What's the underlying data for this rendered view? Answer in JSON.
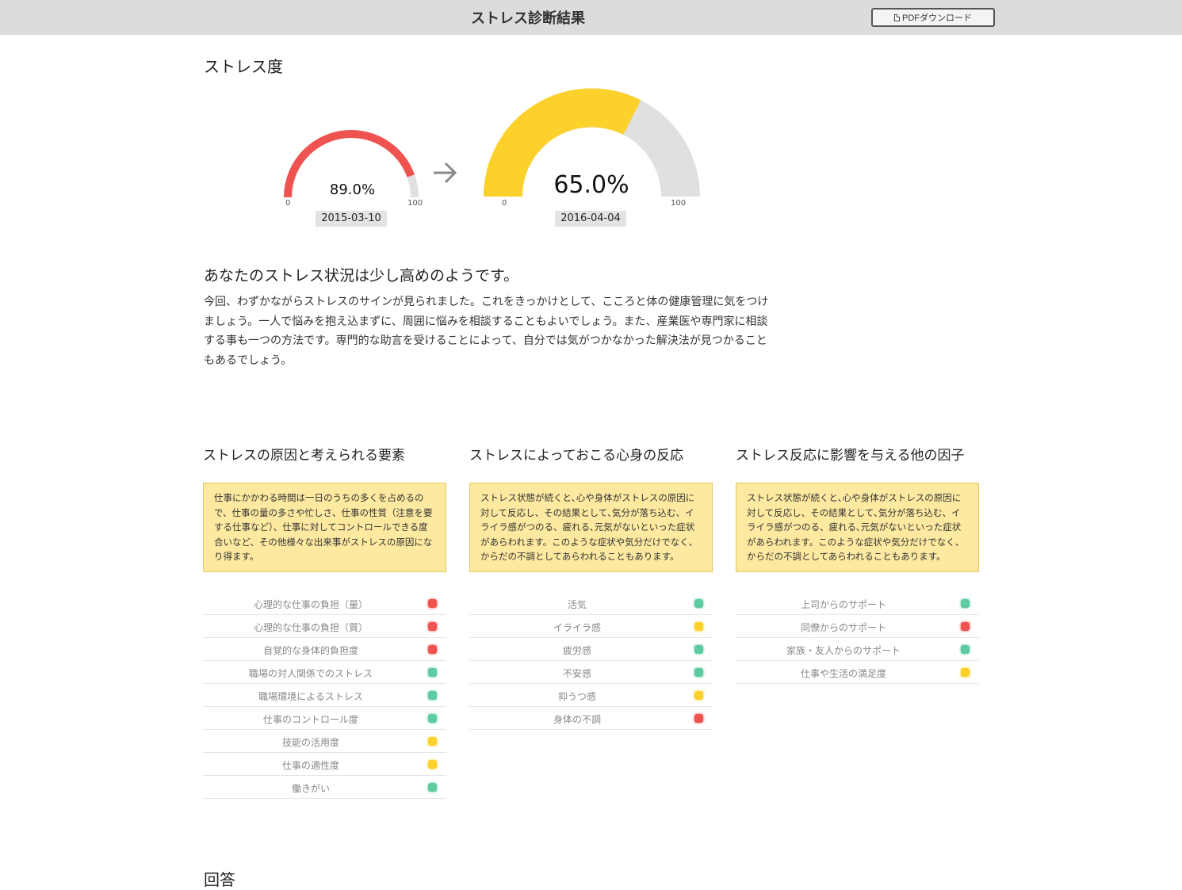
{
  "header": {
    "title": "ストレス診断結果",
    "pdf_button_label": "PDFダウンロード",
    "pdf_icon": "document-icon"
  },
  "stress": {
    "section_title": "ストレス度",
    "previous": {
      "value_label": "89.0%",
      "level": 0.89,
      "date": "2015-03-10",
      "min": "0",
      "max": "100",
      "color": "#ef5350"
    },
    "current": {
      "value_label": "65.0%",
      "level": 0.65,
      "date": "2016-04-04",
      "min": "0",
      "max": "100",
      "color": "#fdd12b"
    },
    "track_color": "#e0e0e0",
    "arrow_icon": "arrow-right-icon"
  },
  "summary": {
    "headline": "あなたのストレス状況は少し高めのようです。",
    "text": "今回、わずかながらストレスのサインが見られました。これをきっかけとして、こころと体の健康管理に気をつけましょう。一人で悩みを抱え込まずに、周囲に悩みを相談することもよいでしょう。また、産業医や専門家に相談する事も一つの方法です。専門的な助言を受けることによって、自分では気がつかなかった解決法が見つかることもあるでしょう。"
  },
  "status_colors": {
    "red": "#ef5350",
    "yellow": "#fdd12b",
    "green": "#5ecba1"
  },
  "columns": [
    {
      "title": "ストレスの原因と考えられる要素",
      "note": "仕事にかかわる時間は一日のうちの多くを占めるので、仕事の量の多さや忙しさ、仕事の性質（注意を要する仕事など）、仕事に対してコントロールできる度合いなど、その他様々な出来事がストレスの原因になり得ます。",
      "items": [
        {
          "label": "心理的な仕事の負担（量）",
          "status": "red"
        },
        {
          "label": "心理的な仕事の負担（質）",
          "status": "red"
        },
        {
          "label": "自覚的な身体的負担度",
          "status": "red"
        },
        {
          "label": "職場の対人関係でのストレス",
          "status": "green"
        },
        {
          "label": "職場環境によるストレス",
          "status": "green"
        },
        {
          "label": "仕事のコントロール度",
          "status": "green"
        },
        {
          "label": "技能の活用度",
          "status": "yellow"
        },
        {
          "label": "仕事の適性度",
          "status": "yellow"
        },
        {
          "label": "働きがい",
          "status": "green"
        }
      ]
    },
    {
      "title": "ストレスによっておこる心身の反応",
      "note": "ストレス状態が続くと､心や身体がストレスの原因に対して反応し、その結果として､気分が落ち込む、イライラ感がつのる、疲れる､元気がないといった症状があらわれます。このような症状や気分だけでなく、からだの不調としてあらわれることもあります。",
      "items": [
        {
          "label": "活気",
          "status": "green"
        },
        {
          "label": "イライラ感",
          "status": "yellow"
        },
        {
          "label": "疲労感",
          "status": "green"
        },
        {
          "label": "不安感",
          "status": "green"
        },
        {
          "label": "抑うつ感",
          "status": "yellow"
        },
        {
          "label": "身体の不調",
          "status": "red"
        }
      ]
    },
    {
      "title": "ストレス反応に影響を与える他の因子",
      "note": "ストレス状態が続くと､心や身体がストレスの原因に対して反応し、その結果として､気分が落ち込む、イライラ感がつのる、疲れる､元気がないといった症状があらわれます。このような症状や気分だけでなく、からだの不調としてあらわれることもあります。",
      "items": [
        {
          "label": "上司からのサポート",
          "status": "green"
        },
        {
          "label": "同僚からのサポート",
          "status": "red"
        },
        {
          "label": "家族・友人からのサポート",
          "status": "green"
        },
        {
          "label": "仕事や生活の満足度",
          "status": "yellow"
        }
      ]
    }
  ],
  "answers": {
    "title": "回答"
  }
}
